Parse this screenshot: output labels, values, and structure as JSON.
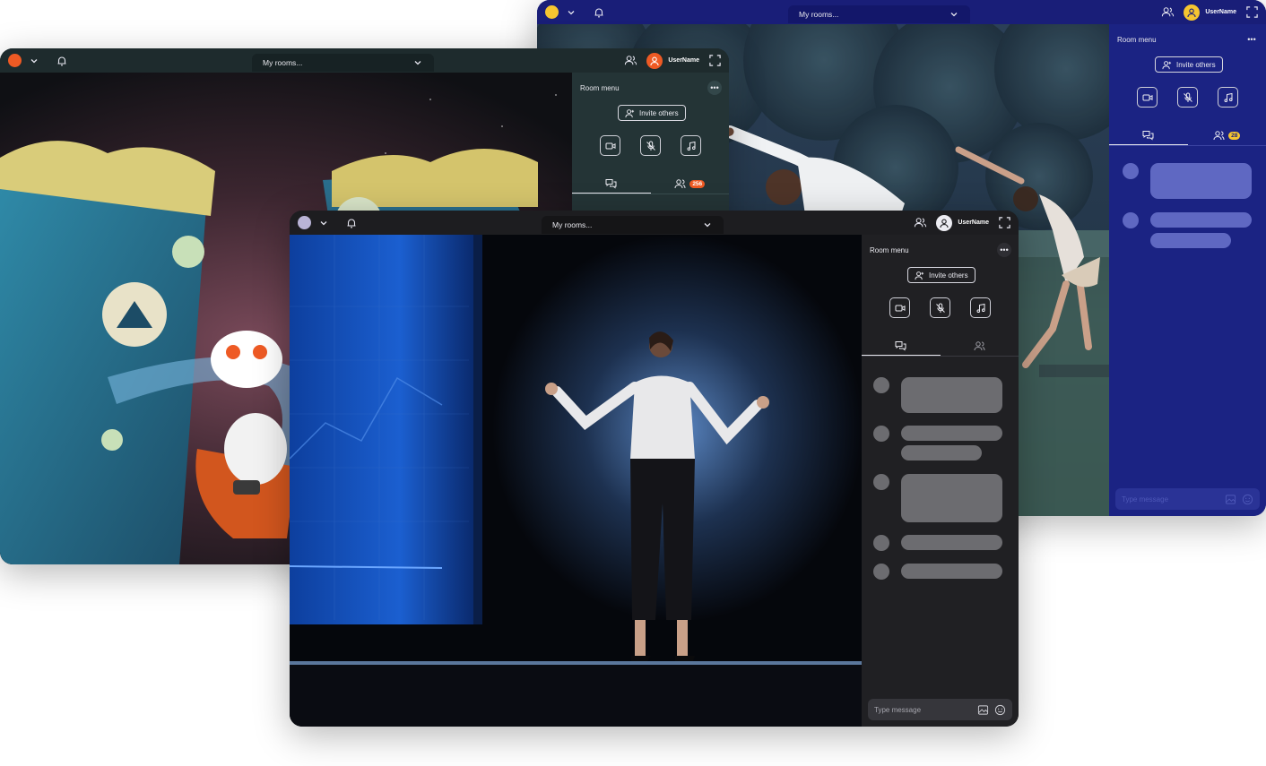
{
  "windows": {
    "movie": {
      "room_select": "My rooms...",
      "username": "UserName",
      "panel_title": "Room menu",
      "invite_label": "Invite others",
      "participants_badge": "256",
      "colors": {
        "bg": "#1f2c2e",
        "panel": "#243436",
        "accent": "#ee5a24",
        "badge": "#ee5a24"
      }
    },
    "yoga": {
      "room_select": "My rooms...",
      "username": "UserName",
      "panel_title": "Room menu",
      "invite_label": "Invite others",
      "participants_badge": "28",
      "composer_placeholder": "Type message",
      "colors": {
        "bg": "#1a1f7a",
        "panel": "#1b2383",
        "accent": "#f5c530",
        "badge": "#f5c530"
      }
    },
    "stage": {
      "room_select": "My rooms...",
      "username": "UserName",
      "panel_title": "Room menu",
      "invite_label": "Invite others",
      "composer_placeholder": "Type message",
      "colors": {
        "bg": "#1c1c1f",
        "panel": "#202023",
        "accent": "#b9b4d6"
      }
    }
  },
  "icons": [
    "chevron-down-icon",
    "bell-icon",
    "users-icon",
    "user-icon",
    "fullscreen-icon",
    "more-icon",
    "add-user-icon",
    "video-icon",
    "mic-off-icon",
    "music-icon",
    "chat-icon",
    "participants-icon",
    "image-icon",
    "emoji-icon"
  ]
}
